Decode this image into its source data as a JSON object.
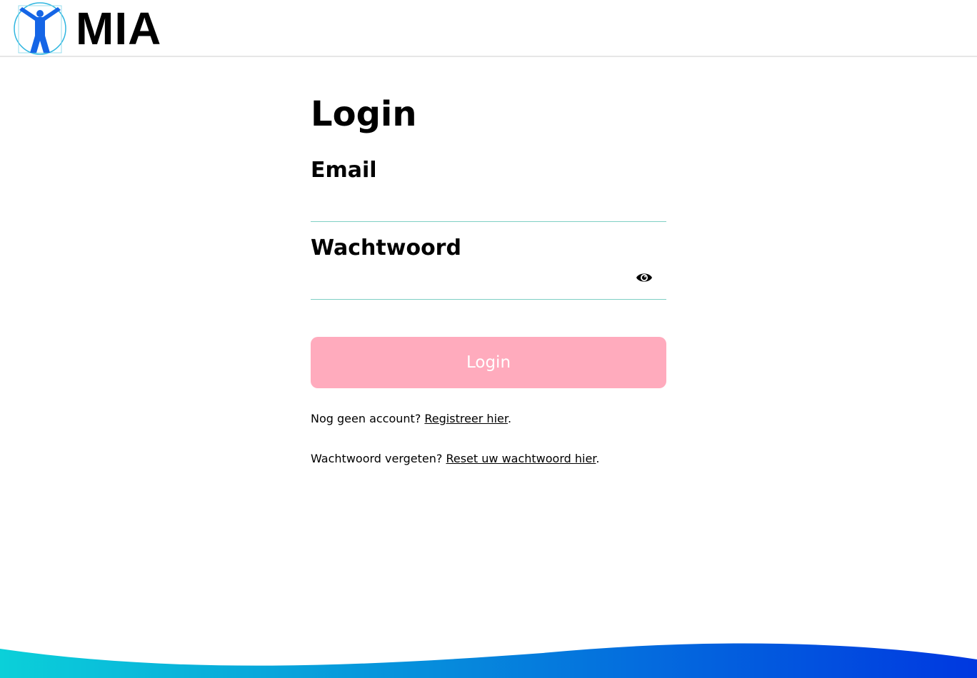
{
  "header": {
    "logo_text": "MIA"
  },
  "login_form": {
    "title": "Login",
    "email_label": "Email",
    "email_value": "",
    "password_label": "Wachtwoord",
    "password_value": "",
    "toggle_visibility_icon": "eye-icon",
    "submit_label": "Login"
  },
  "help": {
    "register_prompt": "Nog geen account? ",
    "register_link": "Registreer hier",
    "register_suffix": ".",
    "reset_prompt": "Wachtwoord vergeten? ",
    "reset_link": "Reset uw wachtwoord hier",
    "reset_suffix": "."
  },
  "colors": {
    "button_background": "#ffabbd",
    "button_text": "#ffffff",
    "input_underline": "#7fd0c4",
    "logo_blue": "#1565e6",
    "logo_ring": "#2fb6e0",
    "wave_start": "#0bd0d9",
    "wave_end": "#0038e0"
  }
}
